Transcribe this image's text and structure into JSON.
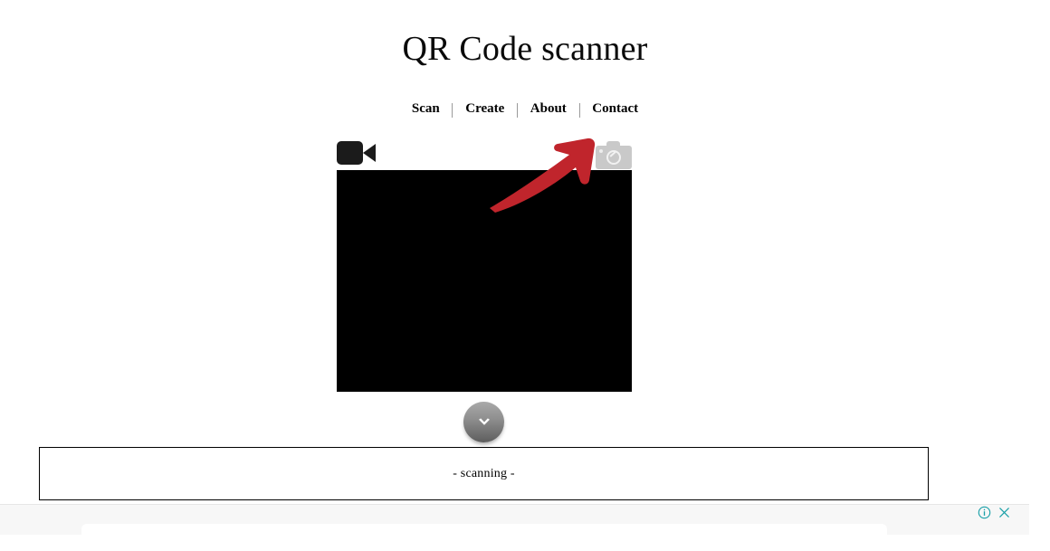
{
  "page": {
    "title": "QR Code scanner"
  },
  "nav": {
    "items": [
      {
        "label": "Scan",
        "name": "nav-link-scan"
      },
      {
        "label": "Create",
        "name": "nav-link-create"
      },
      {
        "label": "About",
        "name": "nav-link-about"
      },
      {
        "label": "Contact",
        "name": "nav-link-contact"
      }
    ],
    "separator": "|"
  },
  "scanner": {
    "video_camera_icon": "videocam-icon",
    "photo_camera_icon": "camera-icon",
    "annotation_arrow": "red-arrow-annotation",
    "arrow_color": "#c0252c",
    "video_feed_label": "camera-video-feed",
    "video_feed_color": "#000000",
    "expand_button_icon": "chevron-down-icon"
  },
  "result": {
    "status_text": "- scanning -"
  },
  "ad": {
    "info_icon": "info-icon",
    "close_icon": "close-icon",
    "icon_color": "#1aa0a8"
  },
  "colors": {
    "background": "#ffffff",
    "text": "#000000",
    "camera_icon_grey": "#c9c9c9",
    "arrow_red": "#c0252c",
    "ad_background": "#f7f7f7"
  }
}
